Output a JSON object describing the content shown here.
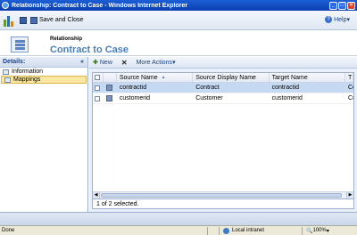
{
  "window": {
    "title": "Relationship: Contract to Case - Windows Internet Explorer",
    "buttons": [
      "_",
      "□",
      "×"
    ]
  },
  "toolbar": {
    "save_close_label": "Save and Close",
    "help_label": "Help",
    "help_arrow": "▾"
  },
  "header": {
    "label": "Relationship",
    "title": "Contract to Case"
  },
  "sidebar": {
    "title": "Details:",
    "collapse_glyph": "«",
    "items": [
      {
        "label": "Information",
        "selected": false
      },
      {
        "label": "Mappings",
        "selected": true
      }
    ]
  },
  "grid_toolbar": {
    "new_label": "New",
    "delete_glyph": "✕",
    "more_actions_label": "More Actions",
    "more_arrow": "▾"
  },
  "grid": {
    "columns": [
      "Source Name",
      "Source Display Name",
      "Target Name",
      "T"
    ],
    "sort_glyph": "▲",
    "rows": [
      {
        "source_name": "contractid",
        "source_display": "Contract",
        "target_name": "contractid",
        "t": "Con",
        "selected": true
      },
      {
        "source_name": "customerid",
        "source_display": "Customer",
        "target_name": "customerid",
        "t": "Cust",
        "selected": false
      }
    ],
    "footer": "1 of 2 selected."
  },
  "statusbar": {
    "status": "Done",
    "zone": "Local intranet",
    "zoom": "100%",
    "zoom_arrow": "▾"
  }
}
